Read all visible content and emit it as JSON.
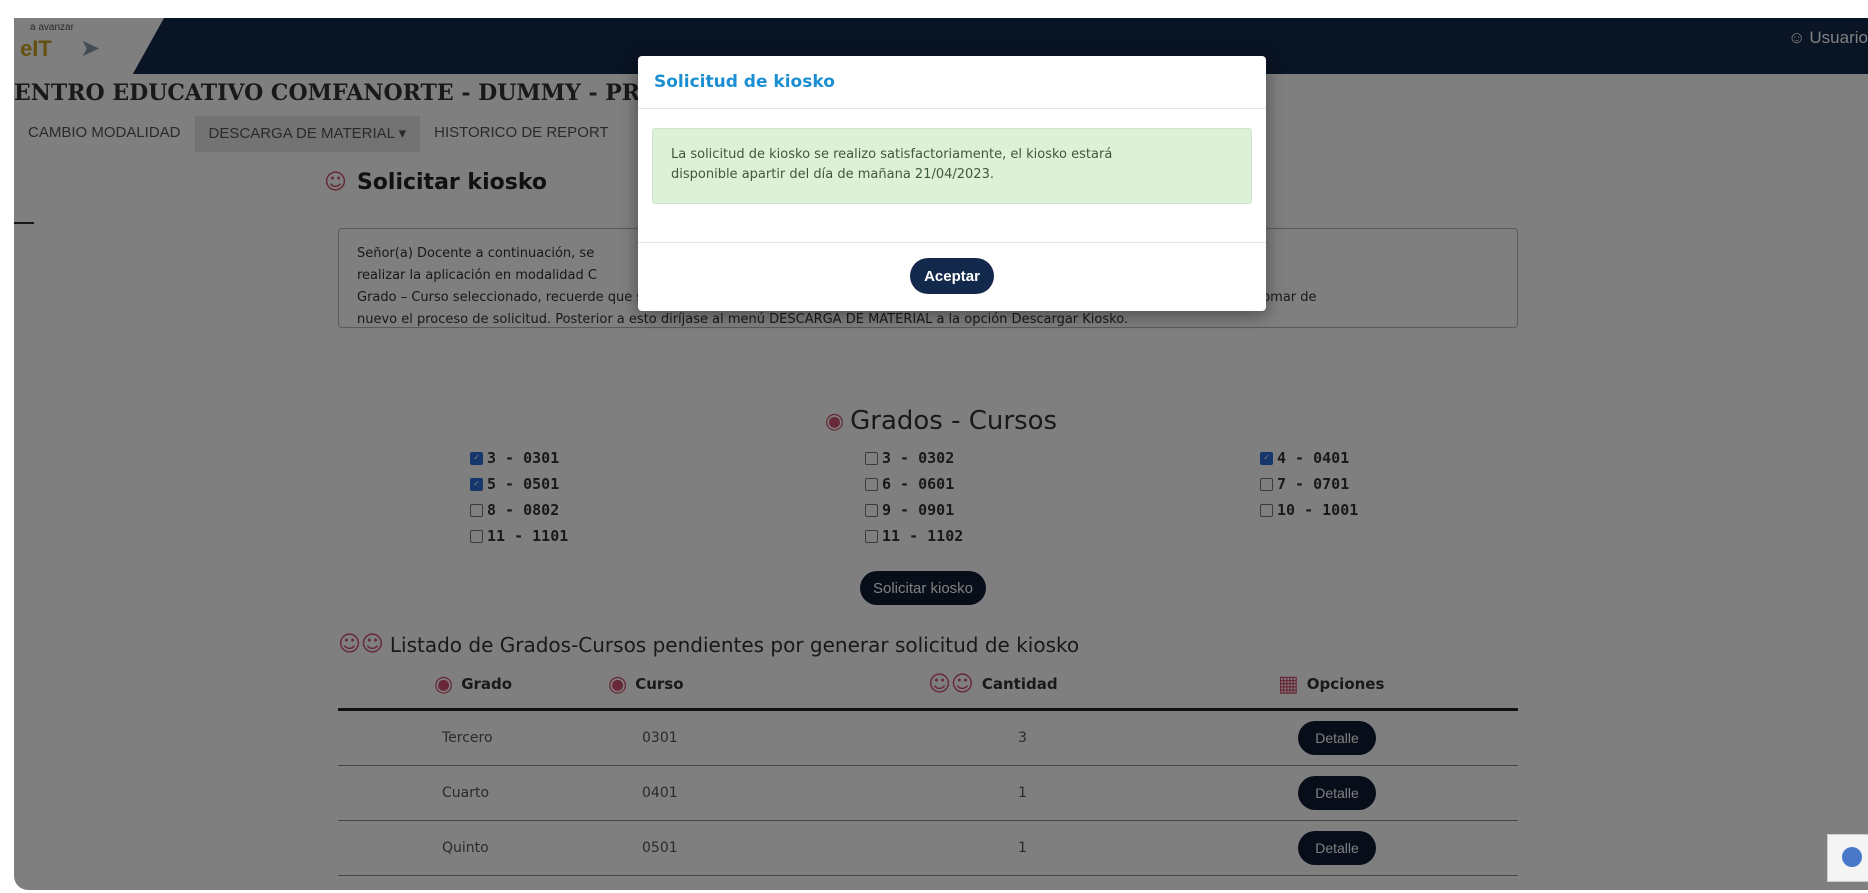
{
  "header": {
    "logo_tagline": "a avanzar",
    "logo_text": "eIT",
    "user_label": "Usuario"
  },
  "school_title": "ENTRO EDUCATIVO COMFANORTE - DUMMY - PRUEBAS -",
  "nav": [
    "CAMBIO MODALIDAD",
    "DESCARGA DE MATERIAL ▾",
    "HISTORICO DE REPORT"
  ],
  "section": {
    "heading": "Solicitar kiosko",
    "info_lines": [
      "Señor(a) Docente a continuación, se                                                                                                                  one aquellos a los que va a",
      "realizar la aplicación en modalidad C                                                                                                           listado de inscritos de cada",
      "Grado – Curso seleccionado, recuerde que si observa faltantes deberá solicitar a su Rector o Director la inscripción  de los estudiantes y retomar de",
      "nuevo el proceso de solicitud. Posterior a esto diríjase al menú DESCARGA DE MATERIAL a la opción Descargar Kiosko."
    ]
  },
  "grados": {
    "title": "Grados - Cursos",
    "items": [
      {
        "label": "3 - 0301",
        "checked": true
      },
      {
        "label": "3 - 0302",
        "checked": false
      },
      {
        "label": "4 - 0401",
        "checked": true
      },
      {
        "label": "5 - 0501",
        "checked": true
      },
      {
        "label": "6 - 0601",
        "checked": false
      },
      {
        "label": "7 - 0701",
        "checked": false
      },
      {
        "label": "8 - 0802",
        "checked": false
      },
      {
        "label": "9 - 0901",
        "checked": false
      },
      {
        "label": "10 - 1001",
        "checked": false
      },
      {
        "label": "11 - 1101",
        "checked": false
      },
      {
        "label": "11 - 1102",
        "checked": false
      }
    ],
    "button_label": "Solicitar kiosko"
  },
  "pending": {
    "heading": "Listado de Grados-Cursos pendientes por generar solicitud de kiosko",
    "columns": [
      "Grado",
      "Curso",
      "Cantidad",
      "Opciones"
    ],
    "rows": [
      {
        "grado": "Tercero",
        "curso": "0301",
        "cantidad": "3",
        "action": "Detalle"
      },
      {
        "grado": "Cuarto",
        "curso": "0401",
        "cantidad": "1",
        "action": "Detalle"
      },
      {
        "grado": "Quinto",
        "curso": "0501",
        "cantidad": "1",
        "action": "Detalle"
      }
    ]
  },
  "modal": {
    "title": "Solicitud de kiosko",
    "message_lines": [
      "La solicitud de kiosko se realizo satisfactoriamente, el kiosko estará",
      "disponible apartir del día de mañana 21/04/2023."
    ],
    "button_label": "Aceptar"
  },
  "colors": {
    "header_bg": "#13294b",
    "modal_title": "#1b8fd1",
    "alert_bg": "#dff0d8",
    "button_bg": "#0e1a33",
    "icon_pink": "#d05070"
  }
}
